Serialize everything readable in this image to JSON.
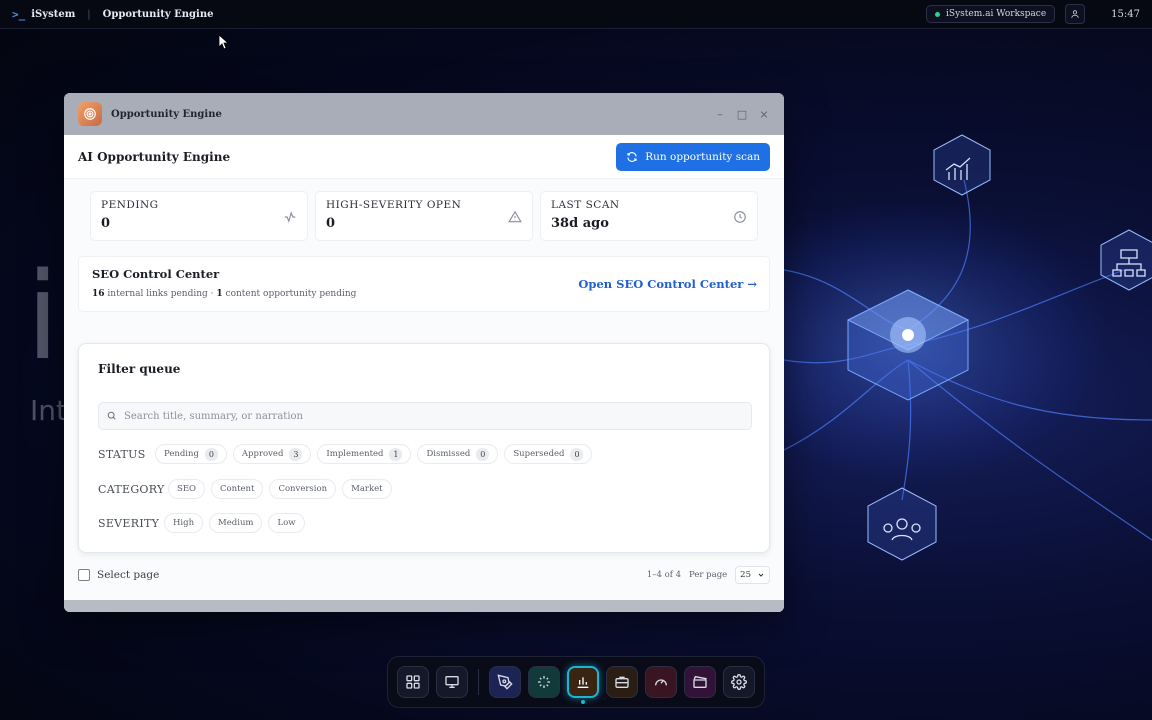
{
  "topbar": {
    "brand": "iSystem",
    "app_title": "Opportunity Engine",
    "workspace": "iSystem.ai Workspace",
    "clock": "15:47"
  },
  "background": {
    "big_letter": "i",
    "tagline_fragment": "Int"
  },
  "window": {
    "title": "Opportunity Engine",
    "header_title": "AI Opportunity Engine",
    "run_button": "Run opportunity scan",
    "stats": [
      {
        "label": "PENDING",
        "value": "0",
        "icon": "activity-icon"
      },
      {
        "label": "HIGH-SEVERITY OPEN",
        "value": "0",
        "icon": "warning-icon"
      },
      {
        "label": "LAST SCAN",
        "value": "38d ago",
        "icon": "clock-icon"
      }
    ],
    "seo": {
      "title": "SEO Control Center",
      "internal_links_count": "16",
      "internal_links_text": "internal links pending ·",
      "content_count": "1",
      "content_text": "content opportunity pending",
      "link": "Open SEO Control Center →"
    },
    "filter": {
      "title": "Filter queue",
      "search_placeholder": "Search title, summary, or narration",
      "status_label": "STATUS",
      "status_chips": [
        {
          "label": "Pending",
          "count": "0"
        },
        {
          "label": "Approved",
          "count": "3"
        },
        {
          "label": "Implemented",
          "count": "1"
        },
        {
          "label": "Dismissed",
          "count": "0"
        },
        {
          "label": "Superseded",
          "count": "0"
        }
      ],
      "category_label": "CATEGORY",
      "category_chips": [
        "SEO",
        "Content",
        "Conversion",
        "Market"
      ],
      "severity_label": "SEVERITY",
      "severity_chips": [
        "High",
        "Medium",
        "Low"
      ]
    },
    "footer": {
      "select_page": "Select page",
      "range": "1–4 of 4",
      "per_page_label": "Per page",
      "per_page_value": "25"
    }
  },
  "dock": {
    "items": [
      "apps-grid-icon",
      "monitor-icon",
      "pen-tool-icon",
      "sparkles-icon",
      "bar-chart-icon",
      "briefcase-icon",
      "gauge-icon",
      "clapperboard-icon",
      "gear-icon"
    ],
    "active": "bar-chart-icon"
  },
  "colors": {
    "accent": "#1f6fe5",
    "link": "#1f5fd0",
    "dock_active": "#19b6d6",
    "status_online": "#2fd08a"
  }
}
